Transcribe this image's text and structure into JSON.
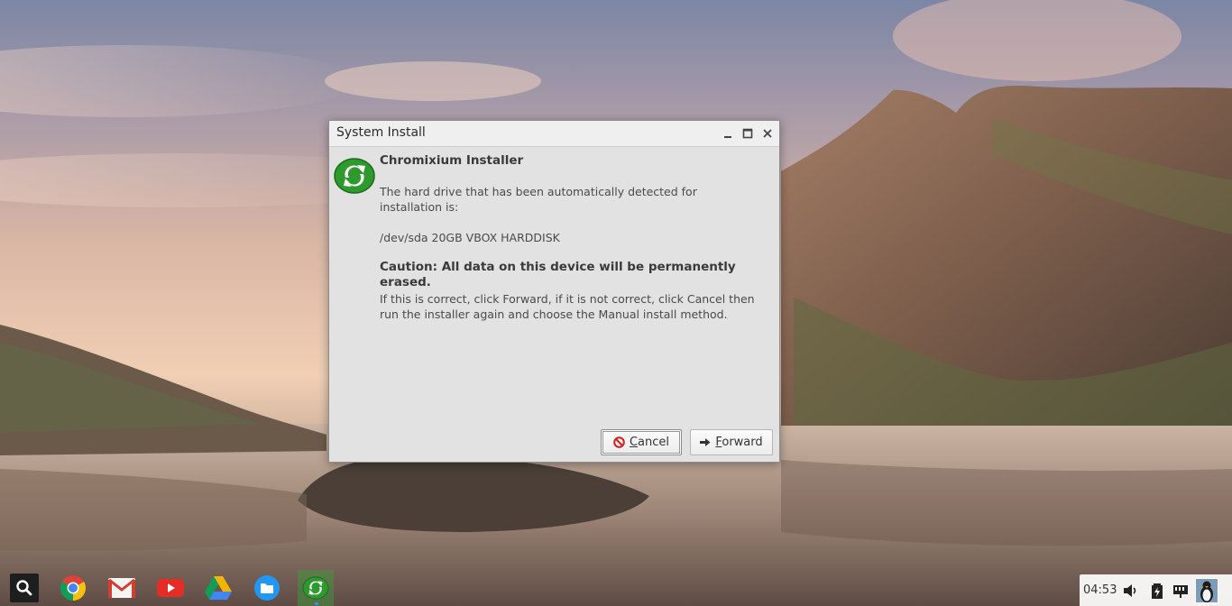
{
  "window": {
    "title": "System Install",
    "controls": [
      "minimize-icon",
      "maximize-icon",
      "close-icon"
    ]
  },
  "installer": {
    "heading": "Chromixium Installer",
    "detected_text": "The hard drive that has been automatically detected for installation is:",
    "disk": "/dev/sda 20GB VBOX HARDDISK",
    "caution": "Caution: All data on this device will be permanently erased.",
    "info": "If this is correct, click Forward, if it is not correct, click Cancel then run the installer again and choose the Manual install method."
  },
  "buttons": {
    "cancel": {
      "mnemonic": "C",
      "rest": "ancel",
      "icon": "cancel-icon"
    },
    "forward": {
      "mnemonic": "F",
      "rest": "orward",
      "icon": "arrow-right-icon"
    }
  },
  "shelf": {
    "apps": [
      "search-icon",
      "chrome-icon",
      "gmail-icon",
      "youtube-icon",
      "drive-icon",
      "files-icon",
      "installer-icon"
    ],
    "active_app": "installer-icon"
  },
  "tray": {
    "time": "04:53",
    "icons": [
      "volume-icon",
      "battery-icon",
      "network-icon",
      "avatar"
    ]
  },
  "colors": {
    "installer_green": "#2e9a2e",
    "cancel_red": "#d42020",
    "shelf_active": "#3ca03c"
  }
}
